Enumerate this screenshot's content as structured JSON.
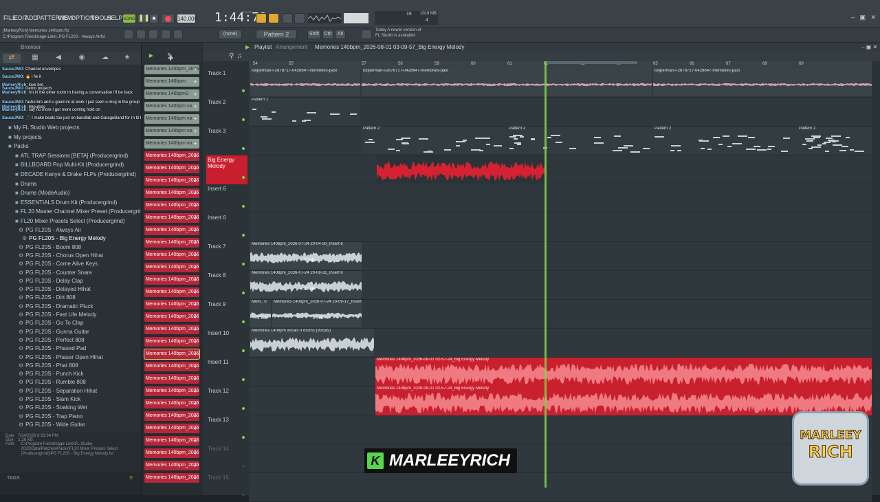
{
  "menu": [
    "FILE",
    "EDIT",
    "ADD",
    "PATTERNS",
    "VIEW",
    "OPTIONS",
    "TOOLS",
    "HELP"
  ],
  "transport": {
    "mode": "SONG",
    "bpm": "140.000",
    "time": "1:44:78",
    "time_label": "M:S:CS",
    "cpu": "16",
    "mem": "1019 MB",
    "voices": "4"
  },
  "hint": {
    "line1": "Today  A newer version of",
    "line2": "FL Studio is available!"
  },
  "project": {
    "line1": "[MarleeyRich] Memories 140bpm.flp",
    "line2": "C:\\Program Files\\Image-Line\\..PG FL20S - Always Airfst"
  },
  "toolbar2": {
    "pattern_select": "(none)",
    "pattern": "Pattern 2",
    "shift": "Shift",
    "ctrl": "Ctrl",
    "alt": "Alt"
  },
  "browser": {
    "title": "Browser",
    "chat": [
      {
        "user": "SauceJMO",
        "text": ": Channel envelopes"
      },
      {
        "user": "SauceJMO",
        "text": ": 🔥 i fw it"
      },
      {
        "user": "MarleeyRich",
        "text": ": love bro"
      },
      {
        "user": "SauceJMO",
        "text": ": Demo projects"
      },
      {
        "user": "MarleeyRich",
        "text": ": i'm in the other room rn having a conversation I'll be back"
      },
      {
        "user": "SauceJMO",
        "text": ": fasho bro and u good im at work I just seen u msg in the group chat"
      },
      {
        "user": "MarleeyRich",
        "text": ": Impulses"
      },
      {
        "user": "MarleeyRich",
        "text": ": say no more I got more coming hold on"
      },
      {
        "user": "SauceJMO",
        "text": ": 🎵 I make beats too just on bandlab and GarageBand for rn til I get a laptop"
      }
    ],
    "items": [
      {
        "label": "My FL Studio Web projects",
        "type": "folder"
      },
      {
        "label": "My projects",
        "type": "folder"
      },
      {
        "label": "Packs",
        "type": "folder"
      },
      {
        "label": "ATL TRAP Sessions [BETA] (Producergrind)",
        "type": "sub"
      },
      {
        "label": "BILLBOARD Pop Multi-Kit (Producergrind)",
        "type": "sub"
      },
      {
        "label": "DECADE Kanye & Drake FLPs (Producergrind)",
        "type": "sub"
      },
      {
        "label": "Drums",
        "type": "sub"
      },
      {
        "label": "Drums (ModeAudio)",
        "type": "sub"
      },
      {
        "label": "ESSENTIALS Drum Kit (Producergrind)",
        "type": "sub"
      },
      {
        "label": "FL 20 Master Channel Mixer Preset (Producergrind)",
        "type": "sub"
      },
      {
        "label": "FL20 Mixer Presets Select (Producergrind)",
        "type": "sub"
      }
    ],
    "presets": [
      "PG FL20S - Always Air",
      "PG FL20S - Big Energy Melody",
      "PG FL20S - Boom 808",
      "PG FL20S - Chorus Open Hihat",
      "PG FL20S - Come Alive Keys",
      "PG FL20S - Counter Snare",
      "PG FL20S - Delay Clap",
      "PG FL20S - Delayed Hihat",
      "PG FL20S - Dirt 808",
      "PG FL20S - Dramatic Pluck",
      "PG FL20S - Fast Life Melody",
      "PG FL20S - Go To Clap",
      "PG FL20S - Gunna Guitar",
      "PG FL20S - Perfect 808",
      "PG FL20S - Phased Pad",
      "PG FL20S - Phaser Open Hihat",
      "PG FL20S - Phat 808",
      "PG FL20S - Punch Kick",
      "PG FL20S - Rumble 808",
      "PG FL20S - Separation Hihat",
      "PG FL20S - Slam Kick",
      "PG FL20S - Soaking Wet",
      "PG FL20S - Trap Piano",
      "PG FL20S - Wide Guitar"
    ],
    "info": {
      "date_label": "Date",
      "date": "7/24/2026 8:19:34 PM",
      "size_label": "Size",
      "size": "1.26 KB",
      "path_label": "Path",
      "path": "C:\\Program Files\\Image-Line\\FL Studio 2025\\Data\\Patches\\Packs\\FL20 Mixer Presets Select (Producergrind)\\PG FL20S - Big Energy Melody.fst"
    },
    "tags": "TAGS"
  },
  "channels": [
    {
      "label": "Memories 140bpm_2026...",
      "color": "gray"
    },
    {
      "label": "Memories 140bpm",
      "color": "gray"
    },
    {
      "label": "Memories 140bpm2",
      "color": "gray"
    },
    {
      "label": "Memories 140bpm vo...",
      "color": "gray"
    },
    {
      "label": "Memories 140bpm vo...",
      "color": "gray"
    },
    {
      "label": "Memories 140bpm vo...",
      "color": "gray"
    },
    {
      "label": "Memories 140bpm vo...",
      "color": "gray"
    },
    {
      "label": "Memories 140bpm_2026...",
      "color": "red"
    },
    {
      "label": "Memories 140bpm_2026...",
      "color": "red"
    },
    {
      "label": "Memories 140bpm_2026...",
      "color": "red"
    },
    {
      "label": "Memories 140bpm_2026...",
      "color": "red"
    },
    {
      "label": "Memories 140bpm_2026...",
      "color": "red"
    },
    {
      "label": "Memories 140bpm_2026...",
      "color": "red"
    },
    {
      "label": "Memories 140bpm_2026...",
      "color": "red"
    },
    {
      "label": "Memories 140bpm_2026...",
      "color": "red"
    },
    {
      "label": "Memories 140bpm_2026...",
      "color": "red"
    },
    {
      "label": "Memories 140bpm_2026...",
      "color": "red"
    },
    {
      "label": "Memories 140bpm_2026...",
      "color": "red"
    },
    {
      "label": "Memories 140bpm_2026...",
      "color": "red"
    },
    {
      "label": "Memories 140bpm_2026...",
      "color": "red"
    },
    {
      "label": "Memories 140bpm_2026...",
      "color": "red"
    },
    {
      "label": "Memories 140bpm_2026...",
      "color": "red"
    },
    {
      "label": "Memories 140bpm_2026...",
      "color": "red"
    },
    {
      "label": "Memories 140bpm_2026...",
      "color": "red",
      "selected": true
    },
    {
      "label": "Memories 140bpm_2026...",
      "color": "red"
    },
    {
      "label": "Memories 140bpm_2026...",
      "color": "red"
    },
    {
      "label": "Memories 140bpm_2026...",
      "color": "red"
    },
    {
      "label": "Memories 140bpm_2026...",
      "color": "red"
    },
    {
      "label": "Memories 140bpm_2026...",
      "color": "red"
    },
    {
      "label": "Memories 140bpm_2026...",
      "color": "red"
    },
    {
      "label": "Memories 140bpm_2026...",
      "color": "red"
    },
    {
      "label": "Memories 140bpm_2026...",
      "color": "red"
    },
    {
      "label": "Memories 140bpm_2026...",
      "color": "red"
    },
    {
      "label": "Memories 140bpm_2026...",
      "color": "red"
    }
  ],
  "playlist": {
    "title": "Playlist",
    "arrangement": "Arrangement",
    "name": "Memories 140bpm_2026-08-01 03-09-57_Big Energy Melody",
    "bars": [
      "54",
      "55",
      "57",
      "58",
      "59",
      "60",
      "61",
      "62",
      "63",
      "64",
      "65",
      "66",
      "67",
      "68",
      "69"
    ],
    "tracks": [
      "Track 1",
      "Track 2",
      "Track 3",
      "Big Energy Melody",
      "Insert 6",
      "Insert 6",
      "Track 7",
      "Track 8",
      "Track 9",
      "Insert 10",
      "Insert 11",
      "Track 12",
      "Track 13",
      "Track 14",
      "Track 15"
    ],
    "clips": {
      "t1a": "looperman-l-2878717-0428647-memories-past",
      "t1b": "looperman-l-2878717-0428647-memories-past",
      "t1c": "looperman-l-2878717-0428647-memories-past",
      "t2": "Pattern 1",
      "t3": "Pattern 2",
      "t7": "Memories 140bpm_2026-07-24 20-04-30_Insert 6",
      "t7vol": "-3.7dB",
      "t8": "Memories 140bpm_2026-07-24 20-08-31_Insert 6",
      "t8vol": "-4.6dB",
      "t9a": "Mem.. 6",
      "t9b": "Memories 140bpm_2026-07-24 20-09-17_Insert 6",
      "t9vol1": "-9.7dB",
      "t9vol2": "-9.7dB",
      "t10": "Memories 140bpm vocals n drums (Vocals)",
      "t11": "Memories 140bpm_2026-08-01 02-57-24_Big Energy Melody",
      "t12": "Memories 140bpm_2026-08-01 02-57-24_Big Energy Melody"
    }
  },
  "overlay": {
    "logo_k": "K",
    "logo_text": "MARLEEYRICH",
    "badge_line1": "MARLEEY",
    "badge_line2": "RICH"
  },
  "colors": {
    "accent": "#7fd14c",
    "clip_red": "#e85a66",
    "clip_dark_red": "#c9202e",
    "channel_red": "#b5283a"
  }
}
